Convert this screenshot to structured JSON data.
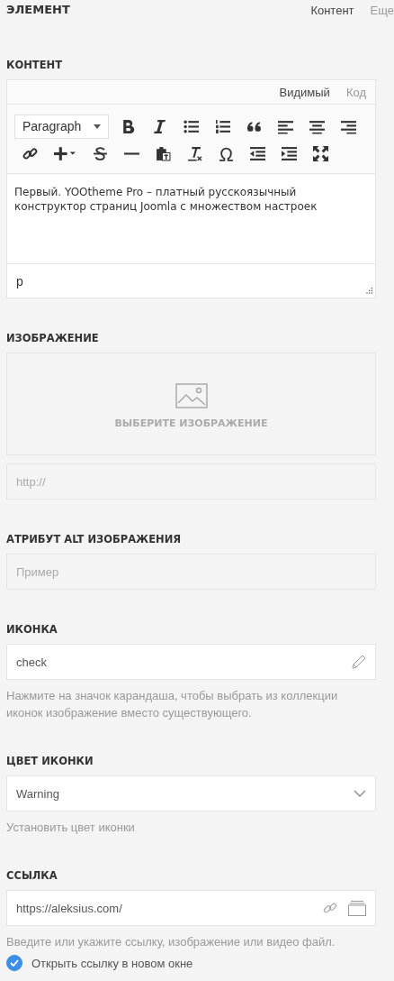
{
  "header": {
    "title": "ЭЛЕМЕНТ",
    "tabs": [
      {
        "label": "Контент",
        "selected": true
      },
      {
        "label": "Еще",
        "selected": false
      }
    ]
  },
  "content": {
    "label": "КОНТЕНТ",
    "editor_tabs": [
      {
        "label": "Видимый",
        "selected": true
      },
      {
        "label": "Код",
        "selected": false
      }
    ],
    "format": "Paragraph",
    "text": "Первый. YOOtheme Pro – платный русскоязычный конструктор страниц Joomla с множеством настроек",
    "path": "p"
  },
  "image": {
    "label": "ИЗОБРАЖЕНИЕ",
    "select": "ВЫБЕРИТЕ ИЗОБРАЖЕНИЕ",
    "url_placeholder": "http://"
  },
  "alt": {
    "label": "АТРИБУТ ALT ИЗОБРАЖЕНИЯ",
    "placeholder": "Пример"
  },
  "icon": {
    "label": "ИКОНКА",
    "value": "check",
    "help": "Нажмите на значок карандаша, чтобы выбрать из коллекции иконок изображение вместо существующего."
  },
  "icon_color": {
    "label": "ЦВЕТ ИКОНКИ",
    "value": "Warning",
    "help": "Установить цвет иконки"
  },
  "link": {
    "label": "ССЫЛКА",
    "value": "https://aleksius.com/",
    "help": "Введите или укажите ссылку, изображение или видео файл.",
    "new_window": {
      "label": "Открыть ссылку в новом окне",
      "checked": true
    }
  }
}
